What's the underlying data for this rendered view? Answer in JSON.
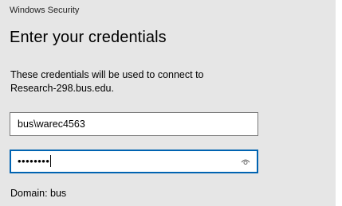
{
  "window": {
    "app_title": "Windows Security",
    "heading": "Enter your credentials"
  },
  "message": {
    "line1": "These credentials will be used to connect to",
    "line2": "Research-298.bus.edu."
  },
  "username": {
    "value": "bus\\warec4563"
  },
  "password": {
    "masked_value": "••••••••",
    "reveal_icon": "eye-icon"
  },
  "domain": {
    "text": "Domain: bus"
  },
  "colors": {
    "dialog_background": "#e6e6e6",
    "focus_border": "#0063b1",
    "field_border": "#7a7a7a"
  }
}
